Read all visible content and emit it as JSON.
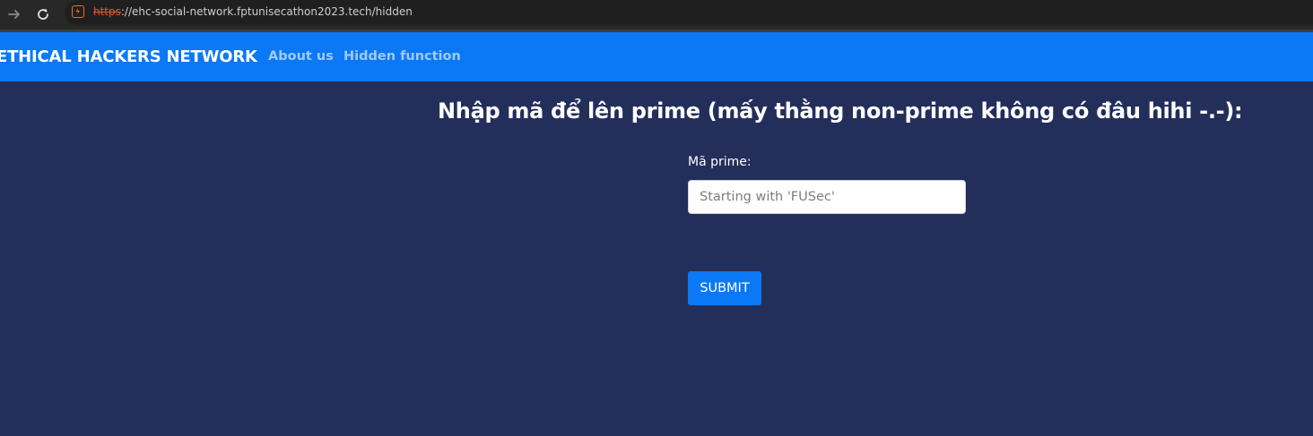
{
  "browser": {
    "url_scheme": "https",
    "url_rest": "://ehc-social-network.fptunisecathon2023.tech/hidden",
    "icons": [
      "forward-arrow-icon",
      "reload-icon",
      "not-secure-icon"
    ]
  },
  "navbar": {
    "brand": "ETHICAL HACKERS NETWORK",
    "links": [
      {
        "label": "About us"
      },
      {
        "label": "Hidden function"
      }
    ]
  },
  "form": {
    "heading": "Nhập mã để lên prime (mấy thằng non-prime không có đâu hihi -.-):",
    "field_label": "Mã prime:",
    "field_value": "",
    "field_placeholder": "Starting with 'FUSec'",
    "submit_label": "SUBMIT"
  },
  "colors": {
    "page_background": "#242e5a",
    "navbar_background": "#0b78f5",
    "nav_link": "#9fcafc",
    "button": "#0b78f5"
  }
}
